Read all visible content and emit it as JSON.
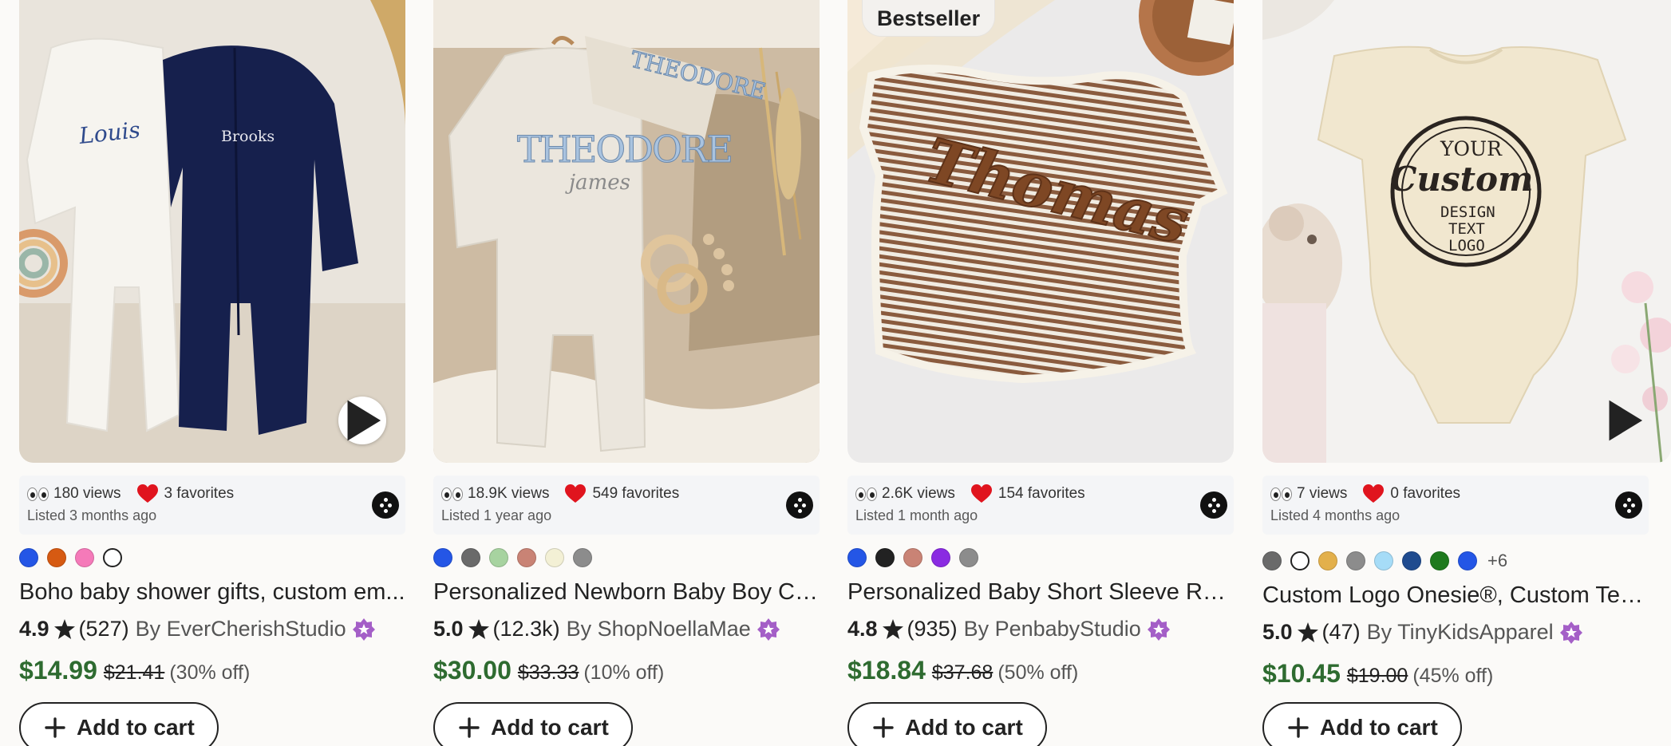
{
  "add_to_cart_label": "Add to cart",
  "listings": [
    {
      "photo_text": [
        "Louis",
        "Brooks"
      ],
      "views": "180 views",
      "favorites": "3 favorites",
      "listed": "Listed 3 months ago",
      "colors": [
        "#2456e6",
        "#d65a12",
        "#f57ab9",
        "#ffffff"
      ],
      "more_colors": "",
      "title": "Boho baby shower gifts, custom em...",
      "rating": "4.9",
      "reviews": "(527)",
      "shop": "By EverCherishStudio",
      "price": "$14.99",
      "original_price": "$21.41",
      "discount": "(30% off)"
    },
    {
      "photo_text": [
        "THEODORE",
        "james",
        "THEODORE"
      ],
      "views": "18.9K views",
      "favorites": "549 favorites",
      "listed": "Listed 1 year ago",
      "colors": [
        "#2456e6",
        "#6a6a6a",
        "#a7d3a0",
        "#c98375",
        "#f3f0d5",
        "#8c8c8c"
      ],
      "more_colors": "",
      "title": "Personalized Newborn Baby Boy Co...",
      "rating": "5.0",
      "reviews": "(12.3k)",
      "shop": "By ShopNoellaMae",
      "price": "$30.00",
      "original_price": "$33.33",
      "discount": "(10% off)"
    },
    {
      "badge": "Bestseller",
      "photo_text": [
        "Thomas"
      ],
      "views": "2.6K views",
      "favorites": "154 favorites",
      "listed": "Listed 1 month ago",
      "colors": [
        "#2456e6",
        "#222222",
        "#c98375",
        "#8a2be2",
        "#8c8c8c"
      ],
      "more_colors": "",
      "title": "Personalized Baby Short Sleeve Ro...",
      "rating": "4.8",
      "reviews": "(935)",
      "shop": "By PenbabyStudio",
      "price": "$18.84",
      "original_price": "$37.68",
      "discount": "(50% off)"
    },
    {
      "photo_text": [
        "YOUR",
        "Custom",
        "DESIGN",
        "TEXT",
        "LOGO"
      ],
      "views": "7 views",
      "favorites": "0 favorites",
      "listed": "Listed 4 months ago",
      "colors": [
        "#6a6a6a",
        "#ffffff",
        "#e3b04b",
        "#8c8c8c",
        "#a6dcf7",
        "#1f4b8f",
        "#1e7a1e",
        "#2456e6"
      ],
      "more_colors": "+6",
      "title": "Custom Logo Onesie®, Custom Text ...",
      "rating": "5.0",
      "reviews": "(47)",
      "shop": "By TinyKidsApparel",
      "price": "$10.45",
      "original_price": "$19.00",
      "discount": "(45% off)"
    }
  ]
}
